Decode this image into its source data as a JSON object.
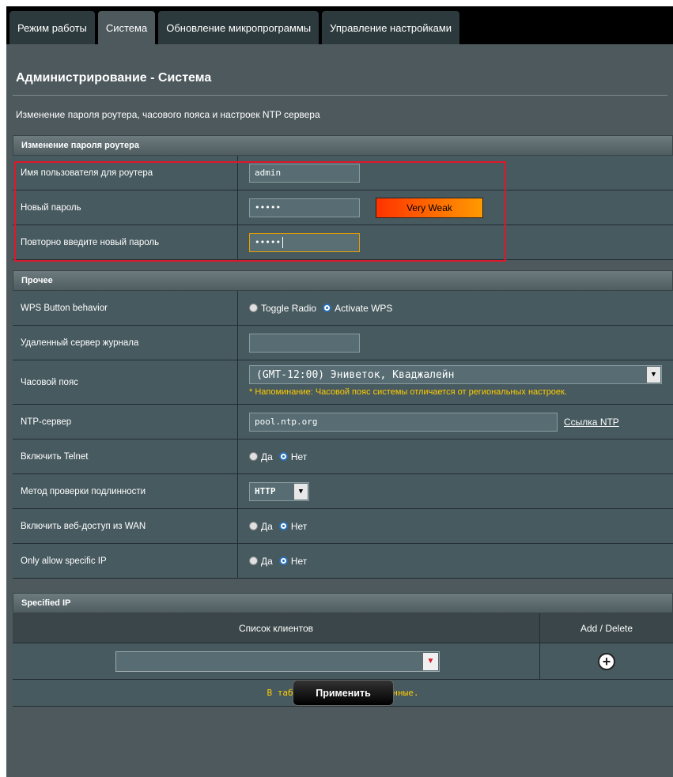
{
  "tabs": [
    {
      "label": "Режим работы",
      "active": false
    },
    {
      "label": "Система",
      "active": true
    },
    {
      "label": "Обновление микропрограммы",
      "active": false
    },
    {
      "label": "Управление настройками",
      "active": false
    }
  ],
  "page": {
    "title": "Администрирование - Система",
    "description": "Изменение пароля роутера, часового пояса и настроек NTP сервера"
  },
  "password_section": {
    "header": "Изменение пароля роутера",
    "username_label": "Имя пользователя для роутера",
    "username_value": "admin",
    "new_password_label": "Новый пароль",
    "new_password_value": "•••••",
    "strength": "Very Weak",
    "confirm_label": "Повторно введите новый пароль",
    "confirm_value": "•••••"
  },
  "misc_section": {
    "header": "Прочее",
    "wps_label": "WPS Button behavior",
    "wps_options": [
      "Toggle Radio",
      "Activate WPS"
    ],
    "wps_selected": "Activate WPS",
    "syslog_label": "Удаленный сервер журнала",
    "syslog_value": "",
    "timezone_label": "Часовой пояс",
    "timezone_value": "(GMT-12:00) Эниветок, Кваджалейн",
    "timezone_note": "* Напоминание: Часовой пояс системы отличается от региональных настроек.",
    "ntp_label": "NTP-сервер",
    "ntp_value": "pool.ntp.org",
    "ntp_link": "Ссылка NTP",
    "telnet_label": "Включить Telnet",
    "auth_label": "Метод проверки подлинности",
    "auth_value": "HTTP",
    "wan_label": "Включить веб-доступ из WAN",
    "specific_ip_label": "Only allow specific IP",
    "yes": "Да",
    "no": "Нет"
  },
  "specified_ip": {
    "header": "Specified IP",
    "col_clients": "Список клиентов",
    "col_add_delete": "Add / Delete",
    "empty_message": "В таблице отсутствуют данные."
  },
  "apply_label": "Применить",
  "colors": {
    "panel": "#4d595d",
    "row": "#475a5f",
    "highlight_border": "#e0162b",
    "note": "#ffcc00"
  }
}
